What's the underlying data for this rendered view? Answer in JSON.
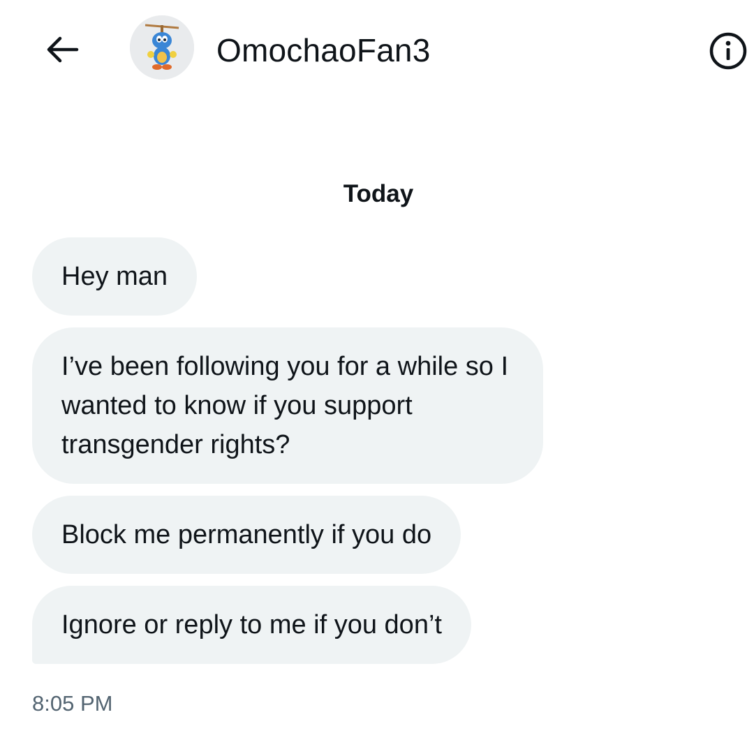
{
  "header": {
    "back_icon": "arrow-left-icon",
    "username": "OmochaoFan3",
    "avatar_icon": "omochao-avatar-icon",
    "info_icon": "info-circle-icon"
  },
  "conversation": {
    "date_label": "Today",
    "messages": [
      {
        "text": "Hey man"
      },
      {
        "text": "I’ve been following you for a while so I wanted to know if you support transgender rights?"
      },
      {
        "text": "Block me permanently if you do"
      },
      {
        "text": "Ignore or reply to me if you don’t"
      }
    ],
    "timestamp": "8:05 PM"
  },
  "colors": {
    "bubble_background": "#eff3f4",
    "text_primary": "#0f1419",
    "text_secondary": "#536471"
  }
}
